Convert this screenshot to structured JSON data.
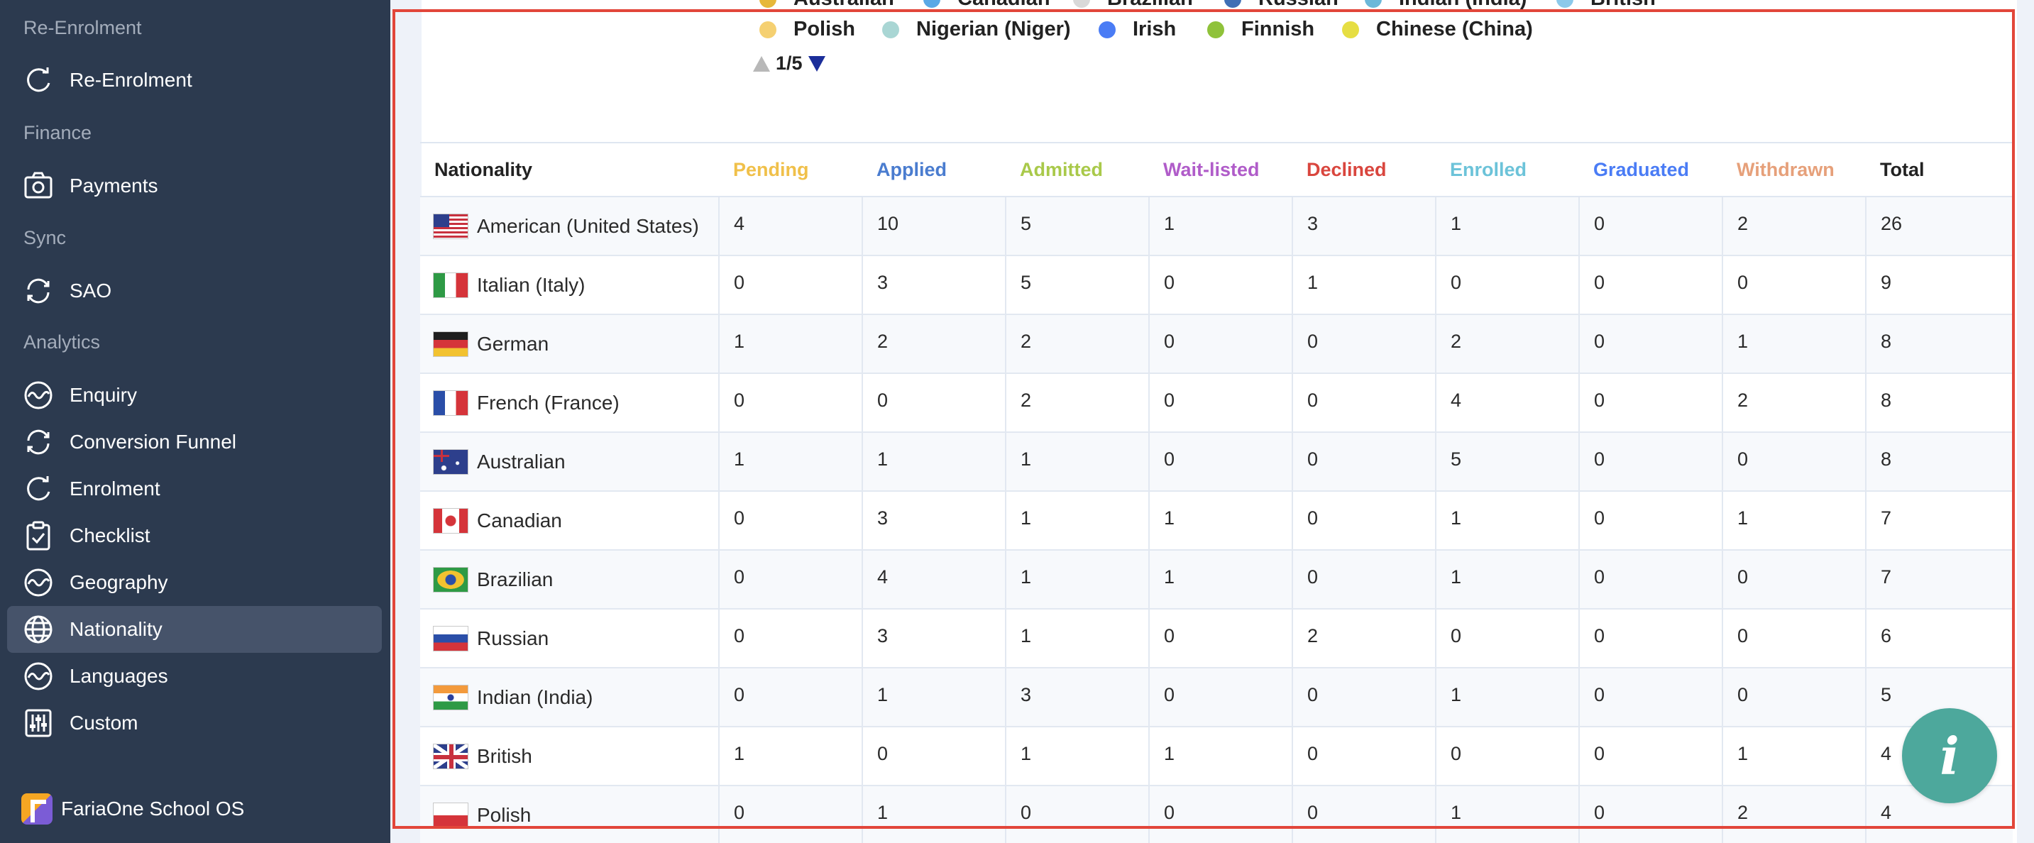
{
  "sidebar": {
    "sections": [
      {
        "label": "Re-Enrolment"
      },
      {
        "label": "Finance"
      },
      {
        "label": "Sync"
      },
      {
        "label": "Analytics"
      }
    ],
    "items": [
      {
        "label": "Re-Enrolment",
        "icon": "refresh-icon"
      },
      {
        "label": "Payments",
        "icon": "camera-icon"
      },
      {
        "label": "SAO",
        "icon": "sync-icon"
      },
      {
        "label": "Enquiry",
        "icon": "wave-icon"
      },
      {
        "label": "Conversion Funnel",
        "icon": "sync-icon"
      },
      {
        "label": "Enrolment",
        "icon": "refresh-icon"
      },
      {
        "label": "Checklist",
        "icon": "clipboard-check-icon"
      },
      {
        "label": "Geography",
        "icon": "wave-icon"
      },
      {
        "label": "Nationality",
        "icon": "globe-icon",
        "active": true
      },
      {
        "label": "Languages",
        "icon": "wave-icon"
      },
      {
        "label": "Custom",
        "icon": "sliders-icon"
      }
    ],
    "brand": "FariaOne School OS"
  },
  "legend": {
    "items_partial": [
      {
        "label": "Australian",
        "color": "#e6b83a"
      },
      {
        "label": "Canadian",
        "color": "#5aa9e6"
      },
      {
        "label": "Brazilian",
        "color": "#d9d9d9"
      },
      {
        "label": "Russian",
        "color": "#3f6fb5"
      },
      {
        "label": "Indian (India)",
        "color": "#6cb8d9"
      },
      {
        "label": "British",
        "color": "#8cc9ea"
      }
    ],
    "items": [
      {
        "label": "Polish",
        "color": "#f5d071"
      },
      {
        "label": "Nigerian (Niger)",
        "color": "#a9d6d4"
      },
      {
        "label": "Irish",
        "color": "#4a7cf5"
      },
      {
        "label": "Finnish",
        "color": "#8fc23a"
      },
      {
        "label": "Chinese (China)",
        "color": "#e6de43"
      }
    ],
    "pager": "1/5"
  },
  "table": {
    "columns": [
      {
        "label": "Nationality",
        "color": "#222222"
      },
      {
        "label": "Pending",
        "color": "#f0c04a"
      },
      {
        "label": "Applied",
        "color": "#4a7ccf"
      },
      {
        "label": "Admitted",
        "color": "#a9c94a"
      },
      {
        "label": "Wait-listed",
        "color": "#b05cc9"
      },
      {
        "label": "Declined",
        "color": "#d9463e"
      },
      {
        "label": "Enrolled",
        "color": "#6cc3d9"
      },
      {
        "label": "Graduated",
        "color": "#4a7cf5"
      },
      {
        "label": "Withdrawn",
        "color": "#e6a07a"
      },
      {
        "label": "Total",
        "color": "#222222"
      }
    ],
    "rows": [
      {
        "nationality": "American (United States)",
        "flag": "us-flag-icon",
        "values": [
          "4",
          "10",
          "5",
          "1",
          "3",
          "1",
          "0",
          "2",
          "26"
        ]
      },
      {
        "nationality": "Italian (Italy)",
        "flag": "italy-flag-icon",
        "values": [
          "0",
          "3",
          "5",
          "0",
          "1",
          "0",
          "0",
          "0",
          "9"
        ]
      },
      {
        "nationality": "German",
        "flag": "germany-flag-icon",
        "values": [
          "1",
          "2",
          "2",
          "0",
          "0",
          "2",
          "0",
          "1",
          "8"
        ]
      },
      {
        "nationality": "French (France)",
        "flag": "france-flag-icon",
        "values": [
          "0",
          "0",
          "2",
          "0",
          "0",
          "4",
          "0",
          "2",
          "8"
        ]
      },
      {
        "nationality": "Australian",
        "flag": "australia-flag-icon",
        "values": [
          "1",
          "1",
          "1",
          "0",
          "0",
          "5",
          "0",
          "0",
          "8"
        ]
      },
      {
        "nationality": "Canadian",
        "flag": "canada-flag-icon",
        "values": [
          "0",
          "3",
          "1",
          "1",
          "0",
          "1",
          "0",
          "1",
          "7"
        ]
      },
      {
        "nationality": "Brazilian",
        "flag": "brazil-flag-icon",
        "values": [
          "0",
          "4",
          "1",
          "1",
          "0",
          "1",
          "0",
          "0",
          "7"
        ]
      },
      {
        "nationality": "Russian",
        "flag": "russia-flag-icon",
        "values": [
          "0",
          "3",
          "1",
          "0",
          "2",
          "0",
          "0",
          "0",
          "6"
        ]
      },
      {
        "nationality": "Indian (India)",
        "flag": "india-flag-icon",
        "values": [
          "0",
          "1",
          "3",
          "0",
          "0",
          "1",
          "0",
          "0",
          "5"
        ]
      },
      {
        "nationality": "British",
        "flag": "uk-flag-icon",
        "values": [
          "1",
          "0",
          "1",
          "1",
          "0",
          "0",
          "0",
          "1",
          "4"
        ]
      },
      {
        "nationality": "Polish",
        "flag": "poland-flag-icon",
        "values": [
          "0",
          "1",
          "0",
          "0",
          "0",
          "1",
          "0",
          "2",
          "4"
        ]
      }
    ]
  },
  "info_button": {
    "label": "i"
  }
}
